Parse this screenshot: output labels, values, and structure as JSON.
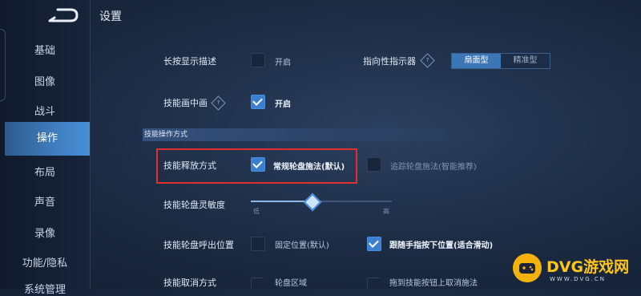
{
  "header": {
    "title": "设置"
  },
  "sidebar": {
    "items": [
      {
        "label": "基础"
      },
      {
        "label": "图像"
      },
      {
        "label": "战斗"
      },
      {
        "label": "操作"
      },
      {
        "label": "布局"
      },
      {
        "label": "声音"
      },
      {
        "label": "录像"
      },
      {
        "label": "功能/隐私"
      },
      {
        "label": "系统管理"
      }
    ],
    "active_index": 3
  },
  "settings": {
    "long_press": {
      "label": "长按显示描述",
      "option": "开启",
      "checked": false
    },
    "direction_indicator": {
      "label": "指向性指示器",
      "help": "?",
      "options": [
        "扇面型",
        "精准型"
      ],
      "selected": "扇面型"
    },
    "skill_pip": {
      "label": "技能画中画",
      "help": "?",
      "option": "开启",
      "checked": true
    },
    "section_title": "技能操作方式",
    "release_mode": {
      "label": "技能释放方式",
      "option1": "常规轮盘施法(默认)",
      "option1_checked": true,
      "option2": "追踪轮盘施法(智能推荐)",
      "option2_checked": false
    },
    "sensitivity": {
      "label": "技能轮盘灵敏度",
      "low": "低",
      "high": "高",
      "value": 0.43
    },
    "wheel_position": {
      "label": "技能轮盘呼出位置",
      "option1": "固定位置(默认)",
      "option1_checked": false,
      "option2": "跟随手指按下位置(适合滑动)",
      "option2_checked": true
    },
    "partial_row": {
      "label": "技能取消方式",
      "option1": "轮盘区域",
      "option2": "拖到技能按钮上取消施法"
    }
  },
  "watermark": {
    "brand": "DVG游戏网",
    "url": "WWW.DVG.CN"
  },
  "colors": {
    "accent": "#3b7fd0",
    "highlight_box": "#e0302d",
    "watermark": "#ffc51a"
  }
}
